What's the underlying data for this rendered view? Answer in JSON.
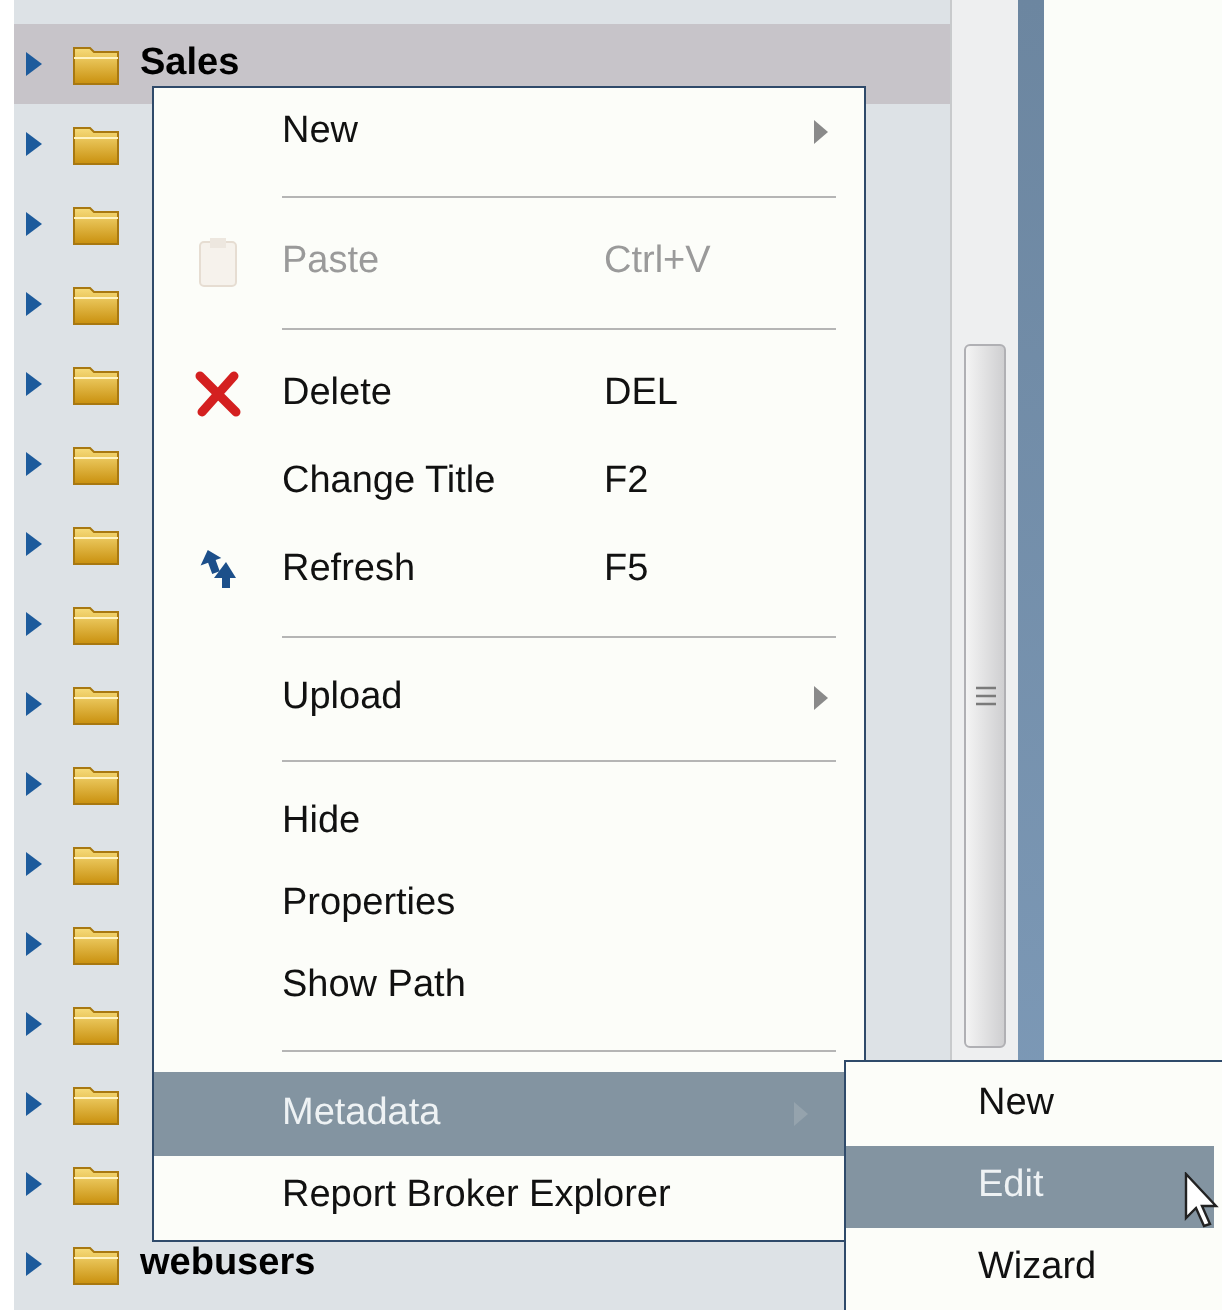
{
  "tree": {
    "rows": [
      {
        "label": "Sales",
        "selected": true
      },
      {
        "selected": false
      },
      {
        "selected": false
      },
      {
        "selected": false
      },
      {
        "selected": false
      },
      {
        "selected": false
      },
      {
        "selected": false
      },
      {
        "selected": false
      },
      {
        "selected": false
      },
      {
        "selected": false
      },
      {
        "selected": false
      },
      {
        "selected": false
      },
      {
        "selected": false
      },
      {
        "selected": false
      },
      {
        "selected": false
      },
      {
        "label": "webusers",
        "selected": false
      }
    ]
  },
  "context_menu": {
    "items": [
      {
        "kind": "submenu",
        "label": "New",
        "disabled": false,
        "selected": false
      },
      {
        "kind": "separator"
      },
      {
        "kind": "item",
        "label": "Paste",
        "shortcut": "Ctrl+V",
        "disabled": true,
        "selected": false
      },
      {
        "kind": "separator"
      },
      {
        "kind": "item",
        "label": "Delete",
        "shortcut": "DEL",
        "disabled": false,
        "selected": false
      },
      {
        "kind": "item",
        "label": "Change Title",
        "shortcut": "F2",
        "disabled": false,
        "selected": false
      },
      {
        "kind": "item",
        "label": "Refresh",
        "shortcut": "F5",
        "disabled": false,
        "selected": false
      },
      {
        "kind": "separator"
      },
      {
        "kind": "submenu",
        "label": "Upload",
        "disabled": false,
        "selected": false
      },
      {
        "kind": "separator"
      },
      {
        "kind": "item",
        "label": "Hide",
        "disabled": false,
        "selected": false
      },
      {
        "kind": "item",
        "label": "Properties",
        "disabled": false,
        "selected": false
      },
      {
        "kind": "item",
        "label": "Show Path",
        "disabled": false,
        "selected": false
      },
      {
        "kind": "separator"
      },
      {
        "kind": "submenu",
        "label": "Metadata",
        "disabled": false,
        "selected": true
      },
      {
        "kind": "item",
        "label": "Report Broker Explorer",
        "disabled": false,
        "selected": false
      }
    ]
  },
  "submenu": {
    "items": [
      {
        "label": "New",
        "selected": false
      },
      {
        "label": "Edit",
        "selected": true
      },
      {
        "label": "Wizard",
        "selected": false
      }
    ]
  }
}
